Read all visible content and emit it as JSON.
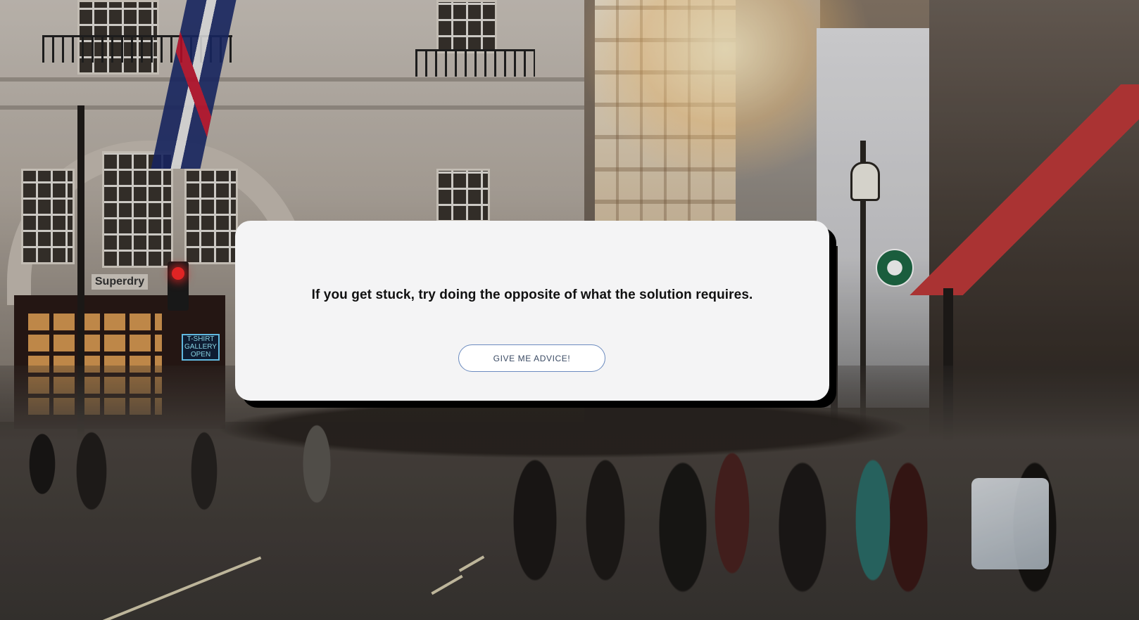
{
  "background": {
    "description_icon": "street-scene-image",
    "shop_sign": "Superdry",
    "neon_sign": "T-SHIRT GALLERY OPEN"
  },
  "card": {
    "advice": "If you get stuck, try doing the opposite of what the solution requires.",
    "button_label": "GIVE ME ADVICE!"
  },
  "colors": {
    "card_bg": "#f4f4f5",
    "card_shadow": "#000000",
    "button_border": "#6b8bbf",
    "button_text": "#3a4a63"
  }
}
